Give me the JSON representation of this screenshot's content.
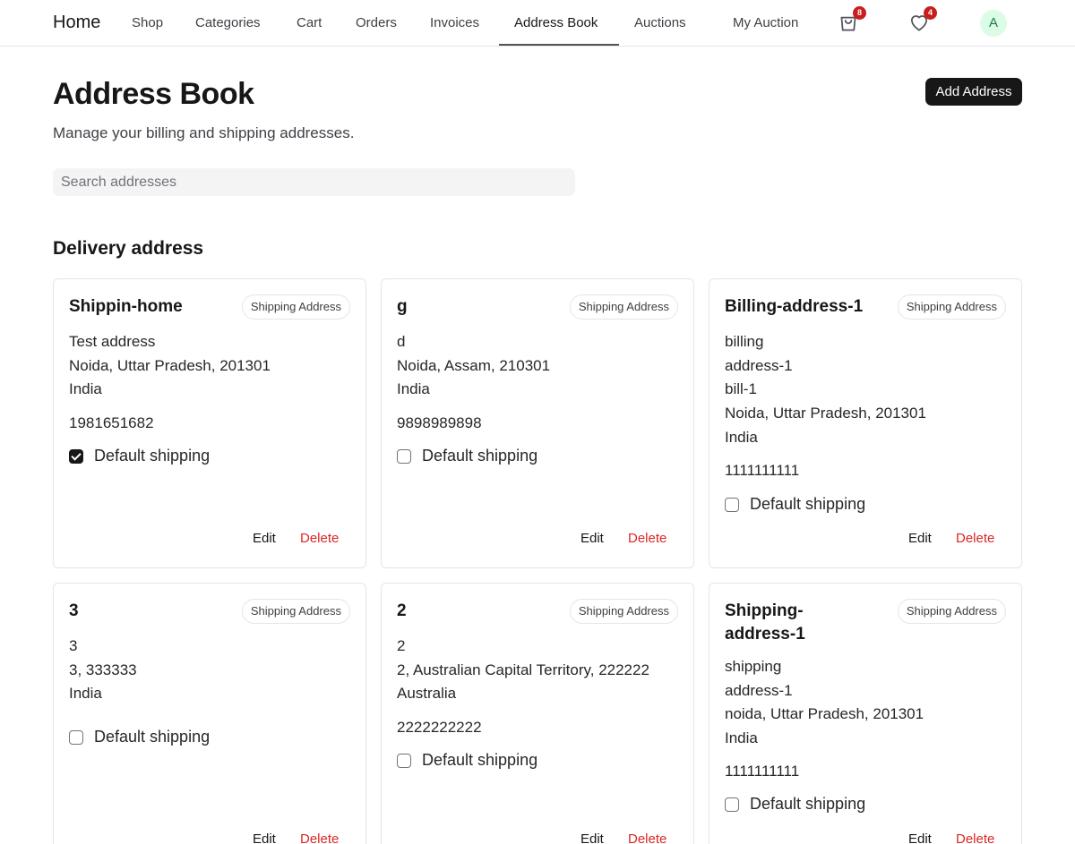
{
  "nav": {
    "home": "Home",
    "links": [
      "Shop",
      "Categories",
      "Cart",
      "Orders",
      "Invoices",
      "Address Book",
      "Auctions",
      "My Auction"
    ],
    "active": "Address Book",
    "cart_count": "8",
    "wishlist_count": "4",
    "avatar_initial": "A"
  },
  "header": {
    "title": "Address Book",
    "subtitle": "Manage your billing and shipping addresses.",
    "add_button": "Add Address"
  },
  "search": {
    "placeholder": "Search addresses",
    "value": ""
  },
  "section_title": "Delivery address",
  "labels": {
    "default_shipping": "Default shipping",
    "edit": "Edit",
    "delete": "Delete"
  },
  "addresses": [
    {
      "name": "Shippin-home",
      "type": "Shipping Address",
      "lines": [
        "Test address",
        "Noida, Uttar Pradesh, 201301",
        "India"
      ],
      "phone": "1981651682",
      "default": true
    },
    {
      "name": "g",
      "type": "Shipping Address",
      "lines": [
        "d",
        "Noida, Assam, 210301",
        "India"
      ],
      "phone": "9898989898",
      "default": false
    },
    {
      "name": "Billing-address-1",
      "type": "Shipping Address",
      "lines": [
        "billing",
        "address-1",
        "bill-1",
        "Noida, Uttar Pradesh, 201301",
        "India"
      ],
      "phone": "1111111111",
      "default": false
    },
    {
      "name": "3",
      "type": "Shipping Address",
      "lines": [
        "3",
        "3, 333333",
        "India"
      ],
      "phone": "",
      "default": false
    },
    {
      "name": "2",
      "type": "Shipping Address",
      "lines": [
        "2",
        "2, Australian Capital Territory, 222222",
        "Australia"
      ],
      "phone": "2222222222",
      "default": false
    },
    {
      "name": "Shipping-address-1",
      "type": "Shipping Address",
      "lines": [
        "shipping",
        "address-1",
        "noida, Uttar Pradesh, 201301",
        "India"
      ],
      "phone": "1111111111",
      "default": false
    }
  ],
  "icons": {
    "cart": "shopping-bag-icon",
    "wishlist": "heart-icon"
  },
  "colors": {
    "primary": "#171717",
    "danger": "#dc2626",
    "badge": "#c81e1e",
    "avatar_bg": "#dcfce7",
    "avatar_fg": "#15803d"
  }
}
